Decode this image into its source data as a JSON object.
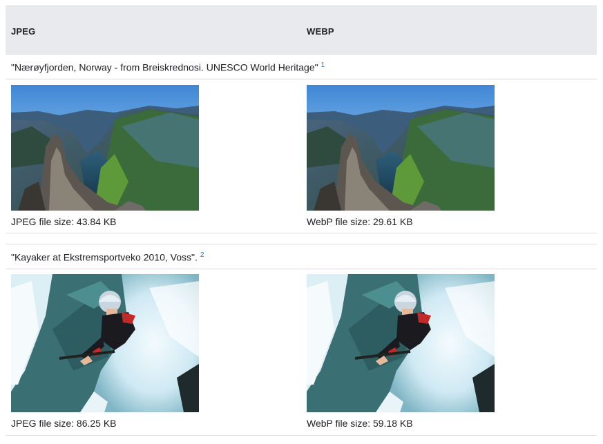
{
  "table": {
    "headers": [
      "JPEG",
      "WEBP"
    ],
    "rows": [
      {
        "caption": "\"Nærøyfjorden, Norway - from Breiskrednosi. UNESCO World Heritage\"",
        "footnote": "1",
        "jpeg_size": "JPEG file size: 43.84 KB",
        "webp_size": "WebP file size: 29.61 KB"
      },
      {
        "caption": "\"Kayaker at Ekstremsportveko 2010, Voss\".",
        "footnote": "2",
        "jpeg_size": "JPEG file size: 86.25 KB",
        "webp_size": "WebP file size: 59.18 KB"
      }
    ]
  },
  "colors": {
    "header_bg": "#e8eaed",
    "border": "#dadce0",
    "link": "#1a73e8"
  }
}
